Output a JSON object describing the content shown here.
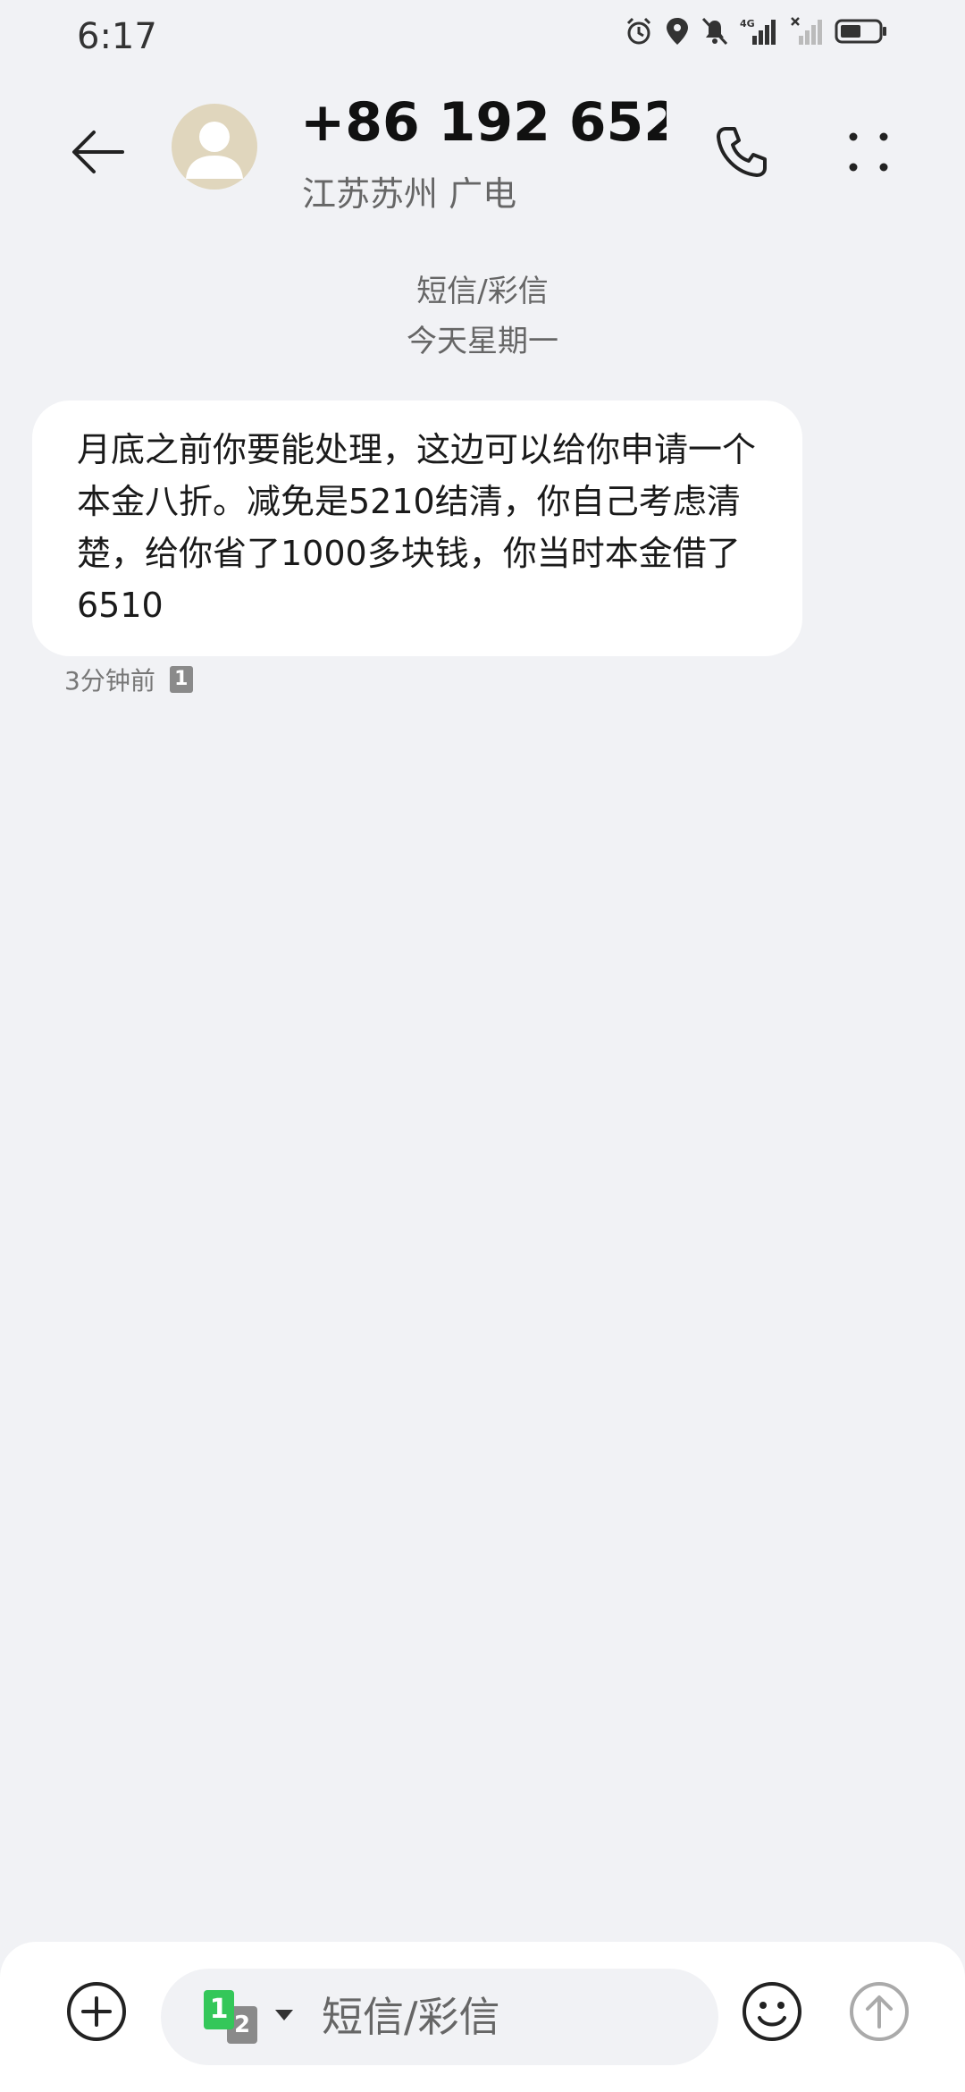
{
  "status_bar": {
    "time": "6:17",
    "icons": [
      "alarm-icon",
      "location-icon",
      "mute-icon",
      "signal-4g-icon",
      "signal-no-service-icon",
      "battery-icon"
    ],
    "network_label": "4G"
  },
  "header": {
    "contact_number": "+86 192 652...",
    "contact_location": "江苏苏州 广电",
    "icons": [
      "back-arrow-icon",
      "avatar-icon",
      "phone-icon",
      "more-icon"
    ]
  },
  "conversation": {
    "channel_label": "短信/彩信",
    "date_label": "今天星期一",
    "messages": [
      {
        "text": "月底之前你要能处理，这边可以给你申请一个本金八折。减免是5210结清，你自己考虑清楚，给你省了1000多块钱，你当时本金借了6510",
        "time": "3分钟前",
        "sim": "1"
      }
    ]
  },
  "compose": {
    "placeholder": "短信/彩信",
    "sim_primary": "1",
    "sim_secondary": "2",
    "icons": [
      "add-icon",
      "sim-selector-icon",
      "emoji-icon",
      "send-icon"
    ]
  },
  "colors": {
    "background": "#f1f2f5",
    "bubble": "#ffffff",
    "sim1": "#34c759",
    "sim2": "#8a8a8a"
  }
}
